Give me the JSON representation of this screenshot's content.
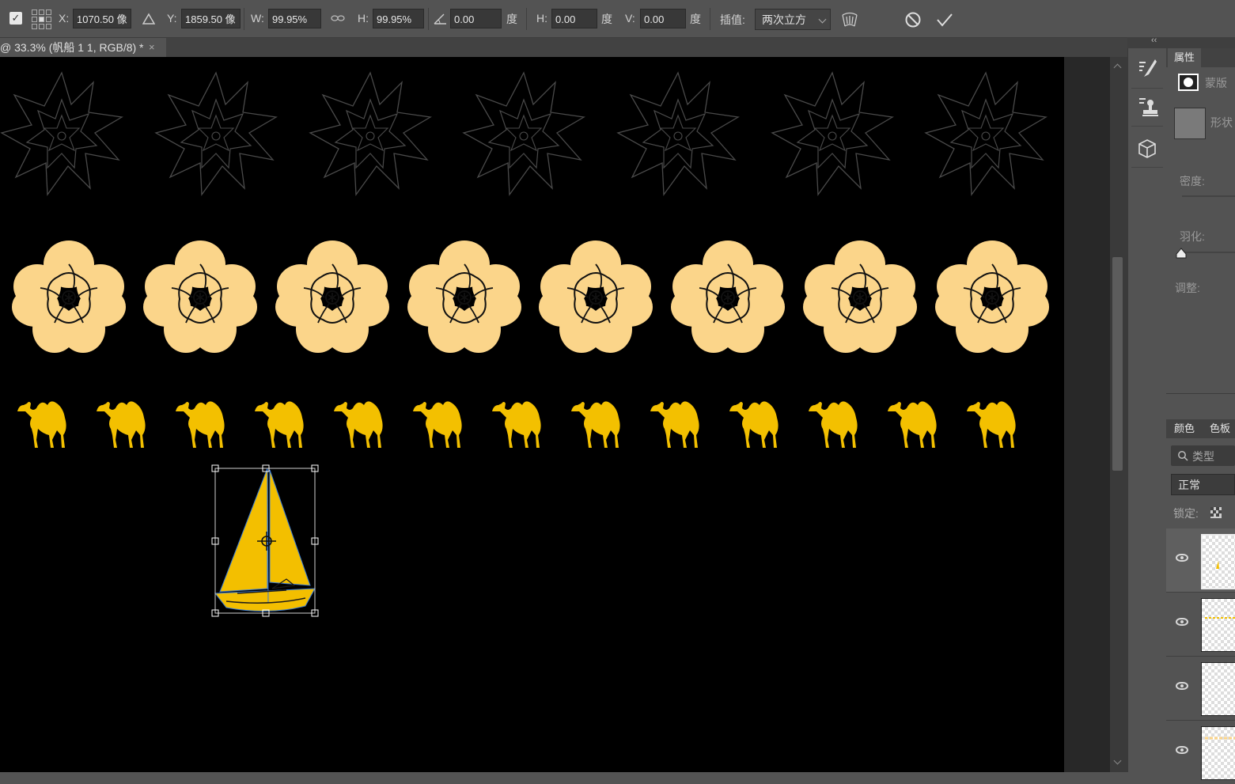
{
  "options_bar": {
    "x_label": "X:",
    "x_value": "1070.50 像",
    "y_label": "Y:",
    "y_value": "1859.50 像",
    "w_label": "W:",
    "w_value": "99.95%",
    "h_label": "H:",
    "h_value": "99.95%",
    "angle_value": "0.00",
    "angle_unit": "度",
    "skew_h_label": "H:",
    "skew_h_value": "0.00",
    "skew_h_unit": "度",
    "skew_v_label": "V:",
    "skew_v_value": "0.00",
    "skew_v_unit": "度",
    "interp_label": "插值:",
    "interp_value": "两次立方"
  },
  "document_tab": {
    "title": "@ 33.3% (帆船 1 1, RGB/8) *",
    "close": "×"
  },
  "panels": {
    "collapse": "‹‹",
    "properties_tab": "属性",
    "mask_label": "蒙版",
    "shape_label": "形状",
    "density_label": "密度:",
    "feather_label": "羽化:",
    "adjust_label": "调整:",
    "color_tab": "颜色",
    "swatch_tab": "色板",
    "search_placeholder": "类型",
    "blend_mode": "正常",
    "lock_label": "锁定:"
  },
  "colors": {
    "flower_fill": "#fbd58a",
    "camel_fill": "#f3c000",
    "sail_fill": "#f3bf00",
    "outline_flower": "#4a4a4a"
  }
}
